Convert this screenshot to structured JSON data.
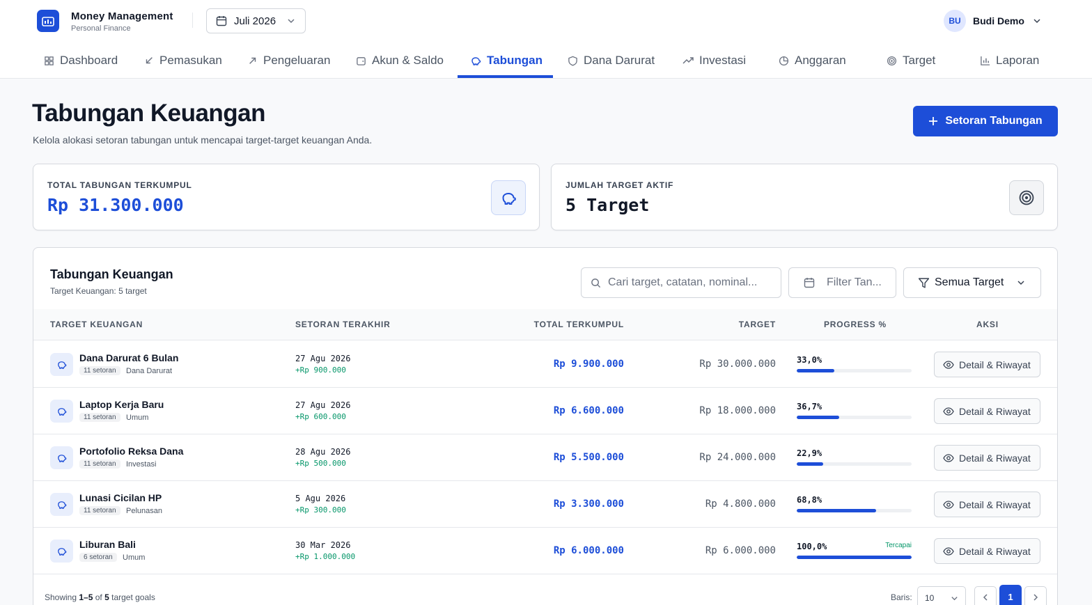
{
  "app": {
    "title": "Money Management",
    "subtitle": "Personal Finance",
    "month": "Juli 2026",
    "user": {
      "initials": "BU",
      "name": "Budi Demo"
    }
  },
  "nav": [
    {
      "label": "Dashboard",
      "icon": "grid-icon"
    },
    {
      "label": "Pemasukan",
      "icon": "arrow-down-left-icon"
    },
    {
      "label": "Pengeluaran",
      "icon": "arrow-up-right-icon"
    },
    {
      "label": "Akun & Saldo",
      "icon": "wallet-icon"
    },
    {
      "label": "Tabungan",
      "icon": "piggy-bank-icon",
      "active": true
    },
    {
      "label": "Dana Darurat",
      "icon": "shield-icon"
    },
    {
      "label": "Investasi",
      "icon": "trending-up-icon"
    },
    {
      "label": "Anggaran",
      "icon": "pie-chart-icon"
    },
    {
      "label": "Target",
      "icon": "target-icon"
    },
    {
      "label": "Laporan",
      "icon": "bar-chart-icon"
    }
  ],
  "page": {
    "title": "Tabungan Keuangan",
    "subtitle": "Kelola alokasi setoran tabungan untuk mencapai target-target keuangan Anda.",
    "primary_action": "Setoran Tabungan"
  },
  "stats": {
    "total_label": "TOTAL TABUNGAN TERKUMPUL",
    "total_value": "Rp 31.300.000",
    "targets_label": "JUMLAH TARGET AKTIF",
    "targets_value": "5 Target"
  },
  "table": {
    "title": "Tabungan Keuangan",
    "subtitle": "Target Keuangan: 5 target",
    "search_placeholder": "Cari target, catatan, nominal...",
    "date_filter": "Filter Tan...",
    "type_filter": "Semua Target",
    "columns": [
      "TARGET KEUANGAN",
      "SETORAN TERAKHIR",
      "TOTAL TERKUMPUL",
      "TARGET",
      "PROGRESS %",
      "AKSI"
    ],
    "action_label": "Detail & Riwayat",
    "rows": [
      {
        "name": "Dana Darurat 6 Bulan",
        "count": "11 setoran",
        "category": "Dana Darurat",
        "date": "27 Agu 2026",
        "delta": "+Rp 900.000",
        "total": "Rp 9.900.000",
        "target": "Rp 30.000.000",
        "progress_label": "33,0%",
        "progress": 0.33,
        "reached": ""
      },
      {
        "name": "Laptop Kerja Baru",
        "count": "11 setoran",
        "category": "Umum",
        "date": "27 Agu 2026",
        "delta": "+Rp 600.000",
        "total": "Rp 6.600.000",
        "target": "Rp 18.000.000",
        "progress_label": "36,7%",
        "progress": 0.367,
        "reached": ""
      },
      {
        "name": "Portofolio Reksa Dana",
        "count": "11 setoran",
        "category": "Investasi",
        "date": "28 Agu 2026",
        "delta": "+Rp 500.000",
        "total": "Rp 5.500.000",
        "target": "Rp 24.000.000",
        "progress_label": "22,9%",
        "progress": 0.229,
        "reached": ""
      },
      {
        "name": "Lunasi Cicilan HP",
        "count": "11 setoran",
        "category": "Pelunasan",
        "date": "5 Agu 2026",
        "delta": "+Rp 300.000",
        "total": "Rp 3.300.000",
        "target": "Rp 4.800.000",
        "progress_label": "68,8%",
        "progress": 0.688,
        "reached": ""
      },
      {
        "name": "Liburan Bali",
        "count": "6 setoran",
        "category": "Umum",
        "date": "30 Mar 2026",
        "delta": "+Rp 1.000.000",
        "total": "Rp 6.000.000",
        "target": "Rp 6.000.000",
        "progress_label": "100,0%",
        "progress": 1.0,
        "reached": "Tercapai"
      }
    ],
    "footer": {
      "prefix": "Showing ",
      "range": "1–5",
      "of": " of ",
      "count": "5",
      "suffix": " target goals",
      "rows_label": "Baris:",
      "rows_value": "10",
      "page": "1"
    }
  },
  "colors": {
    "accent": "#1d4ed8",
    "success": "#059669"
  }
}
